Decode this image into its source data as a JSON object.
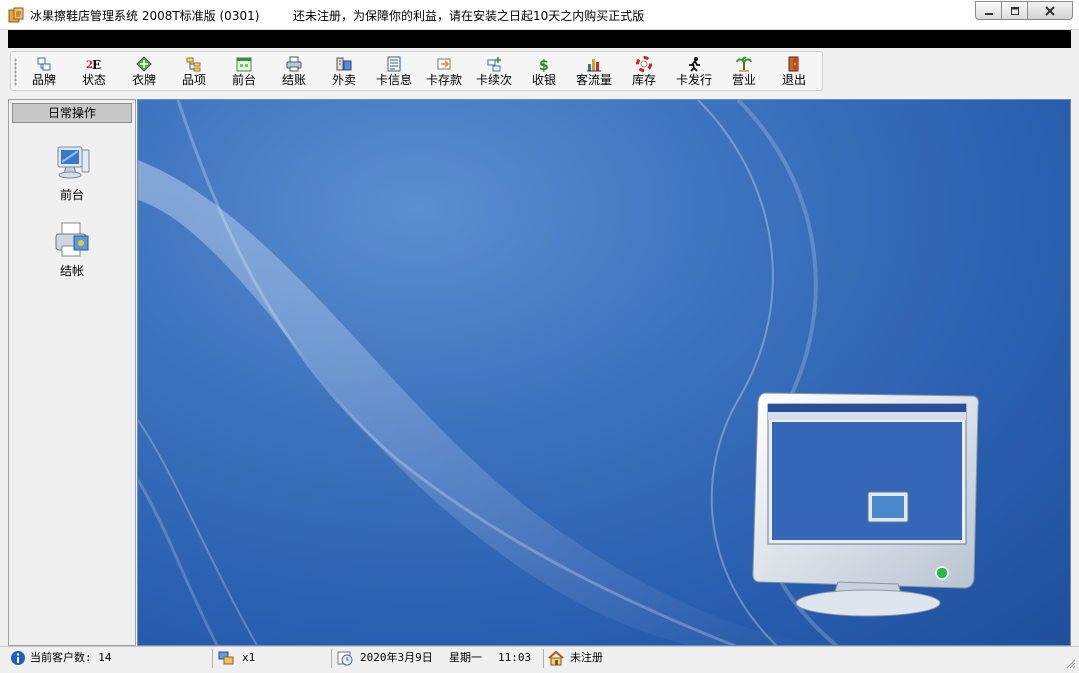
{
  "window": {
    "title": "冰果擦鞋店管理系统  2008T标准版 (0301)",
    "notice": "还未注册，为保障你的利益，请在安装之日起10天之内购买正式版"
  },
  "toolbar": {
    "items": [
      {
        "label": "品牌",
        "icon": "brand-icon"
      },
      {
        "label": "状态",
        "icon": "status-icon"
      },
      {
        "label": "衣牌",
        "icon": "tag-icon"
      },
      {
        "label": "品项",
        "icon": "item-icon"
      },
      {
        "label": "前台",
        "icon": "front-desk-icon"
      },
      {
        "label": "结账",
        "icon": "checkout-icon"
      },
      {
        "label": "外卖",
        "icon": "takeout-icon"
      },
      {
        "label": "卡信息",
        "icon": "card-info-icon"
      },
      {
        "label": "卡存款",
        "icon": "card-deposit-icon"
      },
      {
        "label": "卡续次",
        "icon": "card-renew-icon"
      },
      {
        "label": "收银",
        "icon": "dollar-icon"
      },
      {
        "label": "客流量",
        "icon": "bar-chart-icon"
      },
      {
        "label": "库存",
        "icon": "lifebuoy-icon"
      },
      {
        "label": "卡发行",
        "icon": "runner-icon"
      },
      {
        "label": "营业",
        "icon": "palm-tree-icon"
      },
      {
        "label": "退出",
        "icon": "exit-door-icon"
      }
    ]
  },
  "sidebar": {
    "header": "日常操作",
    "items": [
      {
        "label": "前台",
        "icon": "monitor-icon"
      },
      {
        "label": "结帐",
        "icon": "printer-icon"
      }
    ]
  },
  "statusbar": {
    "customers": "当前客户数: 14",
    "multiplier": "x1",
    "date": "2020年3月9日",
    "weekday": "星期一",
    "time": "11:03",
    "registration": "未注册"
  }
}
